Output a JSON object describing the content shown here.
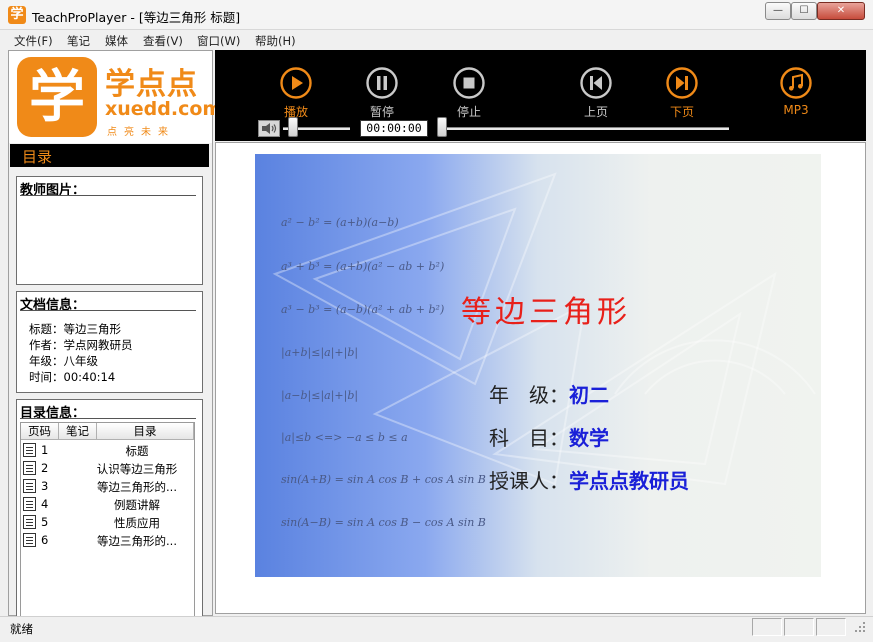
{
  "window": {
    "icon_char": "学",
    "title": "TeachProPlayer - [等边三角形 标题]",
    "min_glyph": "—",
    "max_glyph": "☐",
    "close_glyph": "✕"
  },
  "menu": [
    "文件(F)",
    "笔记",
    "媒体",
    "查看(V)",
    "窗口(W)",
    "帮助(H)"
  ],
  "logo": {
    "mark": "学",
    "name": "学点点",
    "domain": "xuedd.com",
    "slogan": "点亮未来"
  },
  "sidebar": {
    "toc_header": "目录",
    "teacher_title": "教师图片：",
    "doc_title": "文档信息：",
    "doc_info": [
      "标题：等边三角形",
      "作者：学点网教研员",
      "年级：八年级",
      "时间：00:40:14"
    ],
    "toc_title": "目录信息：",
    "toc_columns": [
      "页码",
      "笔记",
      "目录"
    ],
    "toc_rows": [
      {
        "page": "1",
        "title": "标题"
      },
      {
        "page": "2",
        "title": "认识等边三角形"
      },
      {
        "page": "3",
        "title": "等边三角形的..."
      },
      {
        "page": "4",
        "title": "例题讲解"
      },
      {
        "page": "5",
        "title": "性质应用"
      },
      {
        "page": "6",
        "title": "等边三角形的..."
      }
    ]
  },
  "controls": {
    "play": "播放",
    "pause": "暂停",
    "stop": "停止",
    "prev": "上页",
    "next": "下页",
    "mp3": "MP3",
    "time": "00:00:00",
    "volume_level": 0.15,
    "seek_position": 0.0,
    "accent_color": "#f08a18",
    "inactive_color": "#c9c9c9"
  },
  "slide": {
    "formulas": [
      "a² − b² = (a+b)(a−b)",
      "a³ + b³ = (a+b)(a² − ab + b²)",
      "a³ − b³ = (a−b)(a² + ab + b²)",
      "|a+b|≤|a|+|b|",
      "|a−b|≤|a|+|b|",
      "|a|≤b <=> −a ≤ b ≤ a",
      "sin(A+B) = sin A cos B + cos A sin B",
      "sin(A−B) = sin A cos B − cos A sin B"
    ],
    "title": "等边三角形",
    "rows": [
      {
        "label": "年　级：",
        "value": "初二"
      },
      {
        "label": "科　目：",
        "value": "数学"
      },
      {
        "label": "授课人：",
        "value": "学点点教研员"
      }
    ],
    "title_color": "#e8201a",
    "value_color": "#1a20d8"
  },
  "status": {
    "text": "就绪"
  }
}
